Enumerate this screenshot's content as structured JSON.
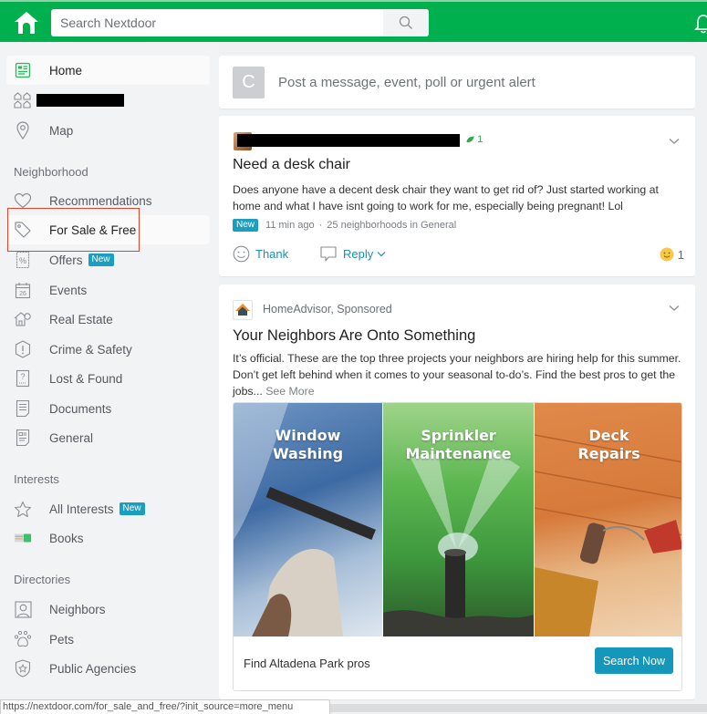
{
  "header": {
    "search_placeholder": "Search Nextdoor",
    "brand_color": "#00b04e"
  },
  "sidebar": {
    "top_items": [
      {
        "label": "Home",
        "icon": "home-feed-icon",
        "active": true
      },
      {
        "label": "",
        "icon": "neighborhood-houses-icon",
        "redacted": true
      },
      {
        "label": "Map",
        "icon": "map-pin-icon"
      }
    ],
    "sections": [
      {
        "heading": "Neighborhood",
        "items": [
          {
            "label": "Recommendations",
            "icon": "heart-icon"
          },
          {
            "label": "For Sale & Free",
            "icon": "price-tag-icon",
            "highlighted": true
          },
          {
            "label": "Offers",
            "icon": "percent-coupon-icon",
            "badge": "New"
          },
          {
            "label": "Events",
            "icon": "calendar-icon",
            "icon_text": "26"
          },
          {
            "label": "Real Estate",
            "icon": "house-icon"
          },
          {
            "label": "Crime & Safety",
            "icon": "alert-hexagon-icon"
          },
          {
            "label": "Lost & Found",
            "icon": "question-box-icon"
          },
          {
            "label": "Documents",
            "icon": "document-icon"
          },
          {
            "label": "General",
            "icon": "general-post-icon"
          }
        ]
      },
      {
        "heading": "Interests",
        "items": [
          {
            "label": "All Interests",
            "icon": "star-icon",
            "badge": "New"
          },
          {
            "label": "Books",
            "icon": "books-icon"
          }
        ]
      },
      {
        "heading": "Directories",
        "items": [
          {
            "label": "Neighbors",
            "icon": "person-icon"
          },
          {
            "label": "Pets",
            "icon": "paw-icon"
          },
          {
            "label": "Public Agencies",
            "icon": "badge-shield-icon"
          }
        ]
      }
    ]
  },
  "composer": {
    "avatar_initial": "C",
    "placeholder": "Post a message, event, poll or urgent alert"
  },
  "post": {
    "author_redacted": true,
    "leaf_count": "1",
    "title": "Need a desk chair",
    "body": "Does anyone have a decent desk chair they want to get rid of? Just started working at home and what I have isnt going to work for me, especially being pregnant! Lol",
    "badge": "New",
    "time": "11 min ago",
    "separator": "·",
    "audience": "25 neighborhoods in General",
    "thank_label": "Thank",
    "reply_label": "Reply",
    "reaction_count": "1"
  },
  "ad": {
    "sponsor": "HomeAdvisor, Sponsored",
    "title": "Your Neighbors Are Onto Something",
    "body": "It’s official. These are the top three projects your neighbors are hiring help for this summer. Don’t get left behind when it comes to your seasonal to-do’s. Find the best pros to get the jobs...",
    "see_more": "See More",
    "panels": [
      {
        "line1": "Window",
        "line2": "Washing"
      },
      {
        "line1": "Sprinkler",
        "line2": "Maintenance"
      },
      {
        "line1": "Deck",
        "line2": "Repairs"
      }
    ],
    "footer_label": "Find Altadena Park pros",
    "cta_label": "Search Now"
  },
  "status_bar": {
    "url": "https://nextdoor.com/for_sale_and_free/?init_source=more_menu"
  },
  "badge_color": "#1a9fc0",
  "link_color": "#1a8fb8"
}
